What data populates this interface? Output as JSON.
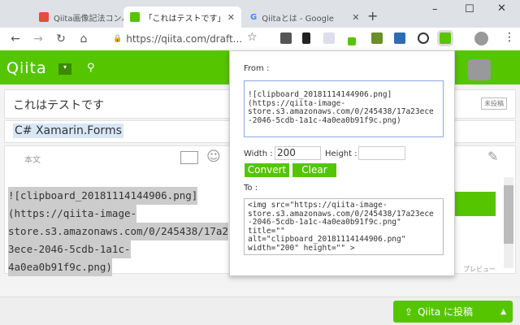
{
  "tabs": [
    {
      "title": "Qiita画像記法コンバ",
      "color": "#e74c3c"
    },
    {
      "title": "「これはテストです」を",
      "color": "#55c500"
    },
    {
      "title": "Qiitaとは - Google",
      "color": "#4285f4"
    }
  ],
  "address": "https://qiita.com/draft...",
  "qiita": {
    "logo": "Qiita",
    "title": "これはテストです",
    "tags": "C# Xamarin.Forms",
    "body_label": "本文",
    "draft_badge": "未投稿",
    "preview_label": "プレビュー",
    "post_button": "Qiita に投稿",
    "body_lines": [
      "![clipboard_20181114144906.png]",
      "(https://qiita-image-",
      "store.s3.amazonaws.com/0/245438/17a2",
      "3ece-2046-5cdb-1a1c-",
      "4a0ea0b91f9c.png)"
    ]
  },
  "popup": {
    "from_label": "From :",
    "from_value": "![clipboard_20181114144906.png]\n(https://qiita-image-\nstore.s3.amazonaws.com/0/245438/17a23ece\n-2046-5cdb-1a1c-4a0ea0b91f9c.png)",
    "width_label": "Width :",
    "width_value": "200",
    "height_label": "Height :",
    "height_value": "",
    "convert": "Convert",
    "clear": "Clear",
    "to_label": "To :",
    "to_value": "<img src=\"https://qiita-image-\nstore.s3.amazonaws.com/0/245438/17a23ece\n-2046-5cdb-1a1c-4a0ea0b91f9c.png\"\ntitle=\"\"\nalt=\"clipboard_20181114144906.png\"\nwidth=\"200\" height=\"\" >"
  }
}
